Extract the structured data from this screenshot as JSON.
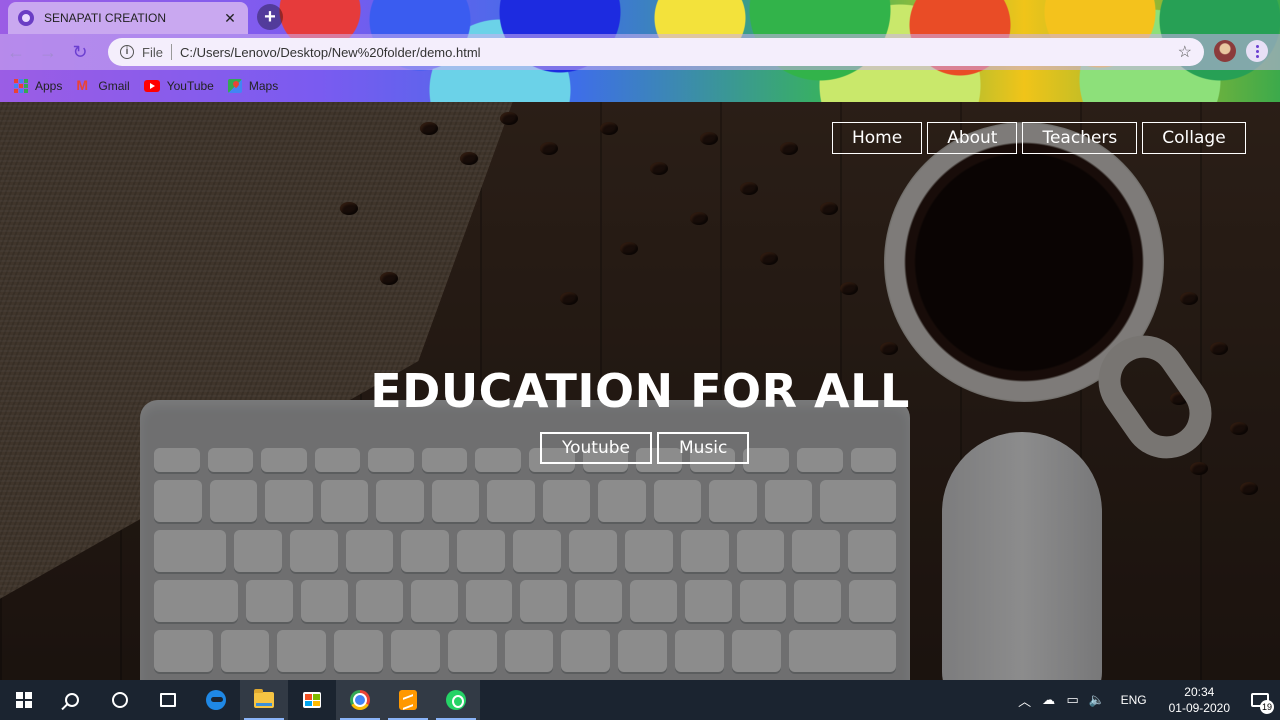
{
  "browser": {
    "tab_title": "SENAPATI CREATION",
    "tab_close": "✕",
    "new_tab": "+",
    "file_label": "File",
    "url": "C:/Users/Lenovo/Desktop/New%20folder/demo.html",
    "bookmarks": [
      {
        "label": "Apps",
        "icon": "apps-grid-icon"
      },
      {
        "label": "Gmail",
        "icon": "gmail-icon"
      },
      {
        "label": "YouTube",
        "icon": "youtube-icon"
      },
      {
        "label": "Maps",
        "icon": "maps-icon"
      }
    ]
  },
  "site": {
    "nav": [
      "Home",
      "About",
      "Teachers",
      "Collage"
    ],
    "hero_title": "EDUCATION FOR ALL",
    "hero_buttons": [
      "Youtube",
      "Music"
    ]
  },
  "taskbar": {
    "apps": [
      "start",
      "search",
      "cortana",
      "task-view",
      "edge",
      "file-explorer",
      "store",
      "chrome",
      "sublime-text",
      "whatsapp"
    ],
    "active_app": "chrome",
    "language": "ENG",
    "time": "20:34",
    "date": "01-09-2020",
    "notification_count": "19"
  },
  "colors": {
    "tab_background": "#c9a8f0",
    "taskbar_background": "#1b2430",
    "nav_border": "#ffffff"
  }
}
